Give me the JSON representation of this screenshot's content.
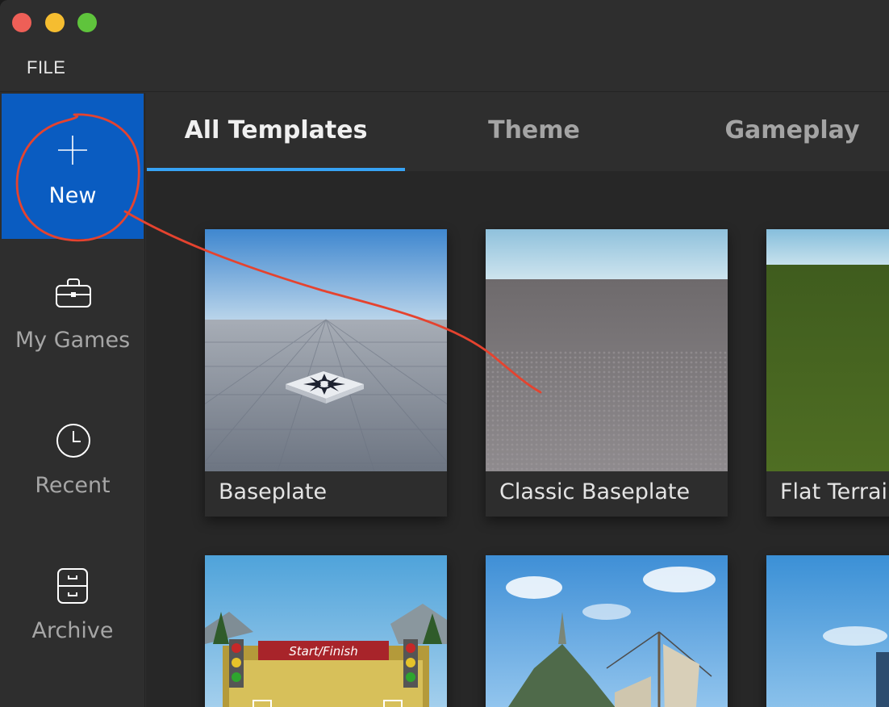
{
  "menu": {
    "file": "FILE"
  },
  "sidebar": {
    "items": [
      {
        "label": "New",
        "icon": "plus-icon",
        "active": true
      },
      {
        "label": "My Games",
        "icon": "briefcase-icon"
      },
      {
        "label": "Recent",
        "icon": "clock-icon"
      },
      {
        "label": "Archive",
        "icon": "archive-cabinet-icon"
      }
    ]
  },
  "tabs": [
    {
      "label": "All Templates",
      "active": true
    },
    {
      "label": "Theme"
    },
    {
      "label": "Gameplay"
    }
  ],
  "templates": [
    {
      "title": "Baseplate"
    },
    {
      "title": "Classic Baseplate"
    },
    {
      "title": "Flat Terrain"
    }
  ],
  "previews": [
    {
      "banner": "Start/Finish"
    }
  ],
  "colors": {
    "accent": "#0a5cc1",
    "tab_underline": "#37a3f5",
    "annotation": "#e5432f"
  }
}
